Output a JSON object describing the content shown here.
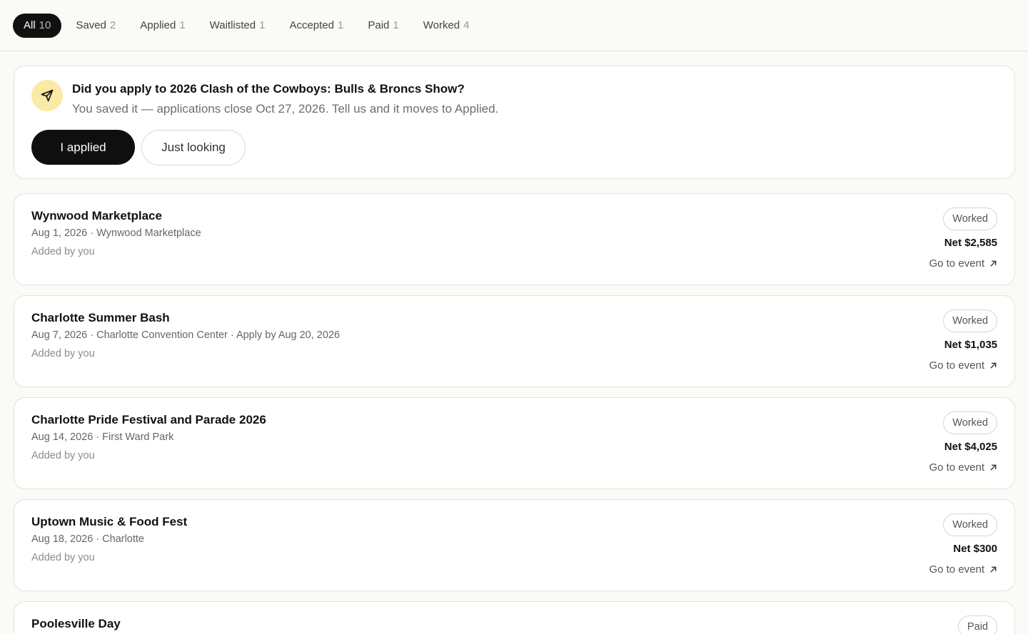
{
  "tabs": [
    {
      "label": "All",
      "count": "10",
      "active": true
    },
    {
      "label": "Saved",
      "count": "2"
    },
    {
      "label": "Applied",
      "count": "1"
    },
    {
      "label": "Waitlisted",
      "count": "1"
    },
    {
      "label": "Accepted",
      "count": "1"
    },
    {
      "label": "Paid",
      "count": "1"
    },
    {
      "label": "Worked",
      "count": "4"
    }
  ],
  "prompt": {
    "icon": "send-icon",
    "title": "Did you apply to 2026 Clash of the Cowboys: Bulls & Broncs Show?",
    "subtitle": "You saved it — applications close Oct 27, 2026. Tell us and it moves to Applied.",
    "primary_label": "I applied",
    "secondary_label": "Just looking"
  },
  "events": [
    {
      "title": "Wynwood Marketplace",
      "meta": "Aug 1, 2026 · Wynwood Marketplace",
      "added": "Added by you",
      "status": "Worked",
      "net": "Net $2,585",
      "link": "Go to event"
    },
    {
      "title": "Charlotte Summer Bash",
      "meta": "Aug 7, 2026 · Charlotte Convention Center · Apply by Aug 20, 2026",
      "added": "Added by you",
      "status": "Worked",
      "net": "Net $1,035",
      "link": "Go to event"
    },
    {
      "title": "Charlotte Pride Festival and Parade 2026",
      "meta": "Aug 14, 2026 · First Ward Park",
      "added": "Added by you",
      "status": "Worked",
      "net": "Net $4,025",
      "link": "Go to event"
    },
    {
      "title": "Uptown Music & Food Fest",
      "meta": "Aug 18, 2026 · Charlotte",
      "added": "Added by you",
      "status": "Worked",
      "net": "Net $300",
      "link": "Go to event"
    },
    {
      "title": "Poolesville Day",
      "status": "Paid"
    }
  ]
}
